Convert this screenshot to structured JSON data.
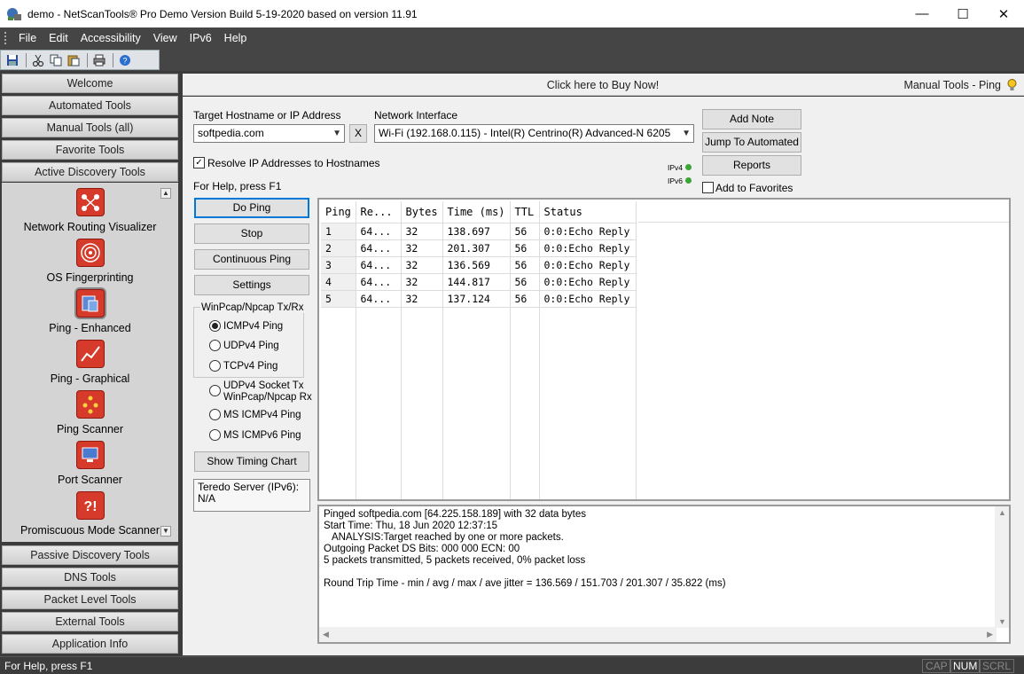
{
  "window": {
    "title": "demo - NetScanTools® Pro Demo Version Build 5-19-2020 based on version 11.91",
    "minimize": "—",
    "maximize": "☐",
    "close": "✕"
  },
  "menu": [
    "File",
    "Edit",
    "Accessibility",
    "View",
    "IPv6",
    "Help"
  ],
  "toolbar": {
    "icons": [
      "save-icon",
      "cut-icon",
      "copy-icon",
      "paste-icon",
      "print-icon",
      "help-icon"
    ]
  },
  "nav_top": [
    "Welcome",
    "Automated Tools",
    "Manual Tools (all)",
    "Favorite Tools",
    "Active Discovery Tools"
  ],
  "tools": [
    {
      "label": "Network Routing Visualizer",
      "icon": "network-routing-icon"
    },
    {
      "label": "OS Fingerprinting",
      "icon": "fingerprint-icon"
    },
    {
      "label": "Ping - Enhanced",
      "icon": "ping-enhanced-icon"
    },
    {
      "label": "Ping - Graphical",
      "icon": "ping-graph-icon"
    },
    {
      "label": "Ping Scanner",
      "icon": "ping-scanner-icon"
    },
    {
      "label": "Port Scanner",
      "icon": "port-scanner-icon"
    },
    {
      "label": "Promiscuous Mode Scanner",
      "icon": "promiscuous-scanner-icon"
    }
  ],
  "nav_bottom": [
    "Passive Discovery Tools",
    "DNS Tools",
    "Packet Level Tools",
    "External Tools",
    "Application Info"
  ],
  "banner": {
    "buy": "Click here to Buy Now!",
    "tool_name": "Manual Tools - Ping"
  },
  "form": {
    "target_label": "Target Hostname or IP Address",
    "target_value": "softpedia.com",
    "clear_label": "X",
    "iface_label": "Network Interface",
    "iface_value": "Wi-Fi (192.168.0.115) - Intel(R) Centrino(R) Advanced-N 6205",
    "resolve_label": "Resolve IP Addresses to Hostnames",
    "help_text": "For Help, press F1",
    "ipv4_label": "IPv4",
    "ipv6_label": "IPv6",
    "favorites_label": "Add to Favorites"
  },
  "buttons": {
    "add_note": "Add Note",
    "jump": "Jump To Automated",
    "reports": "Reports",
    "do_ping": "Do Ping",
    "stop": "Stop",
    "continuous": "Continuous Ping",
    "settings": "Settings",
    "timing_chart": "Show Timing Chart"
  },
  "mode_group": {
    "title": "WinPcap/Npcap Tx/Rx",
    "icmp": "ICMPv4 Ping",
    "udp": "UDPv4 Ping",
    "tcp": "TCPv4 Ping",
    "udp_socket_1": "UDPv4 Socket Tx",
    "udp_socket_2": "WinPcap/Npcap Rx",
    "ms_icmpv4": "MS ICMPv4 Ping",
    "ms_icmpv6": "MS ICMPv6 Ping"
  },
  "teredo": {
    "line1": "Teredo Server (IPv6):",
    "line2": "N/A"
  },
  "table": {
    "headers": [
      "Ping",
      "Re...",
      "Bytes",
      "Time (ms)",
      "TTL",
      "Status"
    ],
    "rows": [
      [
        "1",
        "64...",
        "32",
        "138.697",
        "56",
        "0:0:Echo Reply"
      ],
      [
        "2",
        "64...",
        "32",
        "201.307",
        "56",
        "0:0:Echo Reply"
      ],
      [
        "3",
        "64...",
        "32",
        "136.569",
        "56",
        "0:0:Echo Reply"
      ],
      [
        "4",
        "64...",
        "32",
        "144.817",
        "56",
        "0:0:Echo Reply"
      ],
      [
        "5",
        "64...",
        "32",
        "137.124",
        "56",
        "0:0:Echo Reply"
      ]
    ]
  },
  "log": [
    "Pinged softpedia.com [64.225.158.189] with 32 data bytes",
    "Start Time: Thu, 18 Jun 2020 12:37:15",
    "   ANALYSIS:Target reached by one or more packets.",
    "Outgoing Packet DS Bits: 000 000 ECN: 00",
    "5 packets transmitted, 5 packets received, 0% packet loss",
    "",
    "Round Trip Time - min / avg / max / ave jitter = 136.569 / 151.703 / 201.307 / 35.822 (ms)"
  ],
  "status": {
    "help": "For Help, press F1",
    "cap": "CAP",
    "num": "NUM",
    "scrl": "SCRL"
  },
  "colors": {
    "accent": "#0078d7",
    "icon_red": "#d63a2a",
    "status_ok": "#3aa635"
  }
}
